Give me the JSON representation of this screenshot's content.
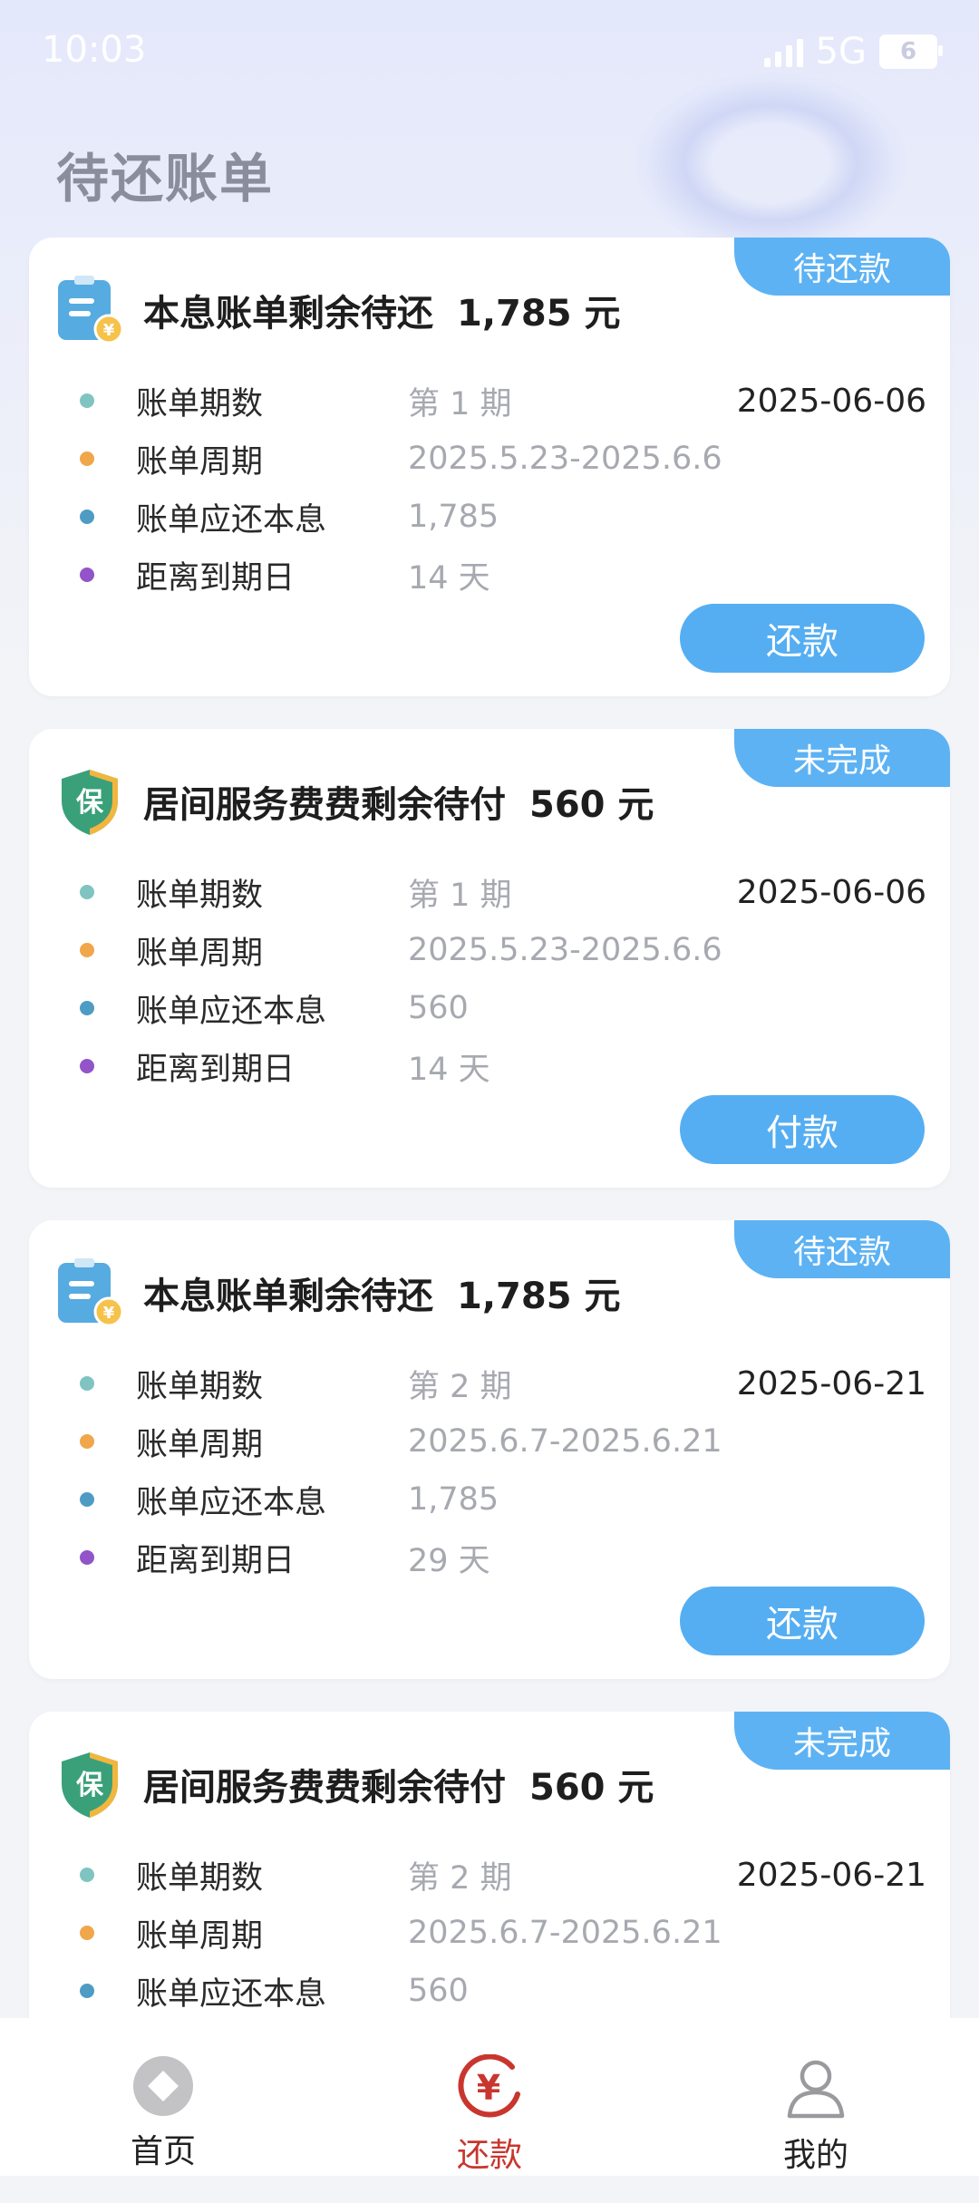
{
  "status_bar": {
    "time": "10:03",
    "network": "5G",
    "battery": "6"
  },
  "page_title": "待还账单",
  "colors": {
    "accent": "#5db2f3",
    "dot_period": "#7fc4c0",
    "dot_cycle": "#f0a64a",
    "dot_amount": "#4e9cc4",
    "dot_due": "#9254c8",
    "active_tab": "#c8362e"
  },
  "cards": [
    {
      "icon": "bill-icon",
      "badge": "待还款",
      "title": "本息账单剩余待还",
      "amount": "1,785 元",
      "date": "2025-06-06",
      "rows": [
        {
          "label": "账单期数",
          "value": "第 1 期"
        },
        {
          "label": "账单周期",
          "value": "2025.5.23-2025.6.6"
        },
        {
          "label": "账单应还本息",
          "value": "1,785"
        },
        {
          "label": "距离到期日",
          "value": "14 天"
        }
      ],
      "button": "还款"
    },
    {
      "icon": "shield-icon",
      "badge": "未完成",
      "title": "居间服务费费剩余待付",
      "amount": "560 元",
      "date": "2025-06-06",
      "rows": [
        {
          "label": "账单期数",
          "value": "第 1 期"
        },
        {
          "label": "账单周期",
          "value": "2025.5.23-2025.6.6"
        },
        {
          "label": "账单应还本息",
          "value": "560"
        },
        {
          "label": "距离到期日",
          "value": "14 天"
        }
      ],
      "button": "付款"
    },
    {
      "icon": "bill-icon",
      "badge": "待还款",
      "title": "本息账单剩余待还",
      "amount": "1,785 元",
      "date": "2025-06-21",
      "rows": [
        {
          "label": "账单期数",
          "value": "第 2 期"
        },
        {
          "label": "账单周期",
          "value": "2025.6.7-2025.6.21"
        },
        {
          "label": "账单应还本息",
          "value": "1,785"
        },
        {
          "label": "距离到期日",
          "value": "29 天"
        }
      ],
      "button": "还款"
    },
    {
      "icon": "shield-icon",
      "badge": "未完成",
      "title": "居间服务费费剩余待付",
      "amount": "560 元",
      "date": "2025-06-21",
      "rows": [
        {
          "label": "账单期数",
          "value": "第 2 期"
        },
        {
          "label": "账单周期",
          "value": "2025.6.7-2025.6.21"
        },
        {
          "label": "账单应还本息",
          "value": "560"
        }
      ]
    }
  ],
  "shield_char": "保",
  "yuan_char": "¥",
  "tabs": [
    {
      "label": "首页",
      "icon": "home-icon",
      "active": false
    },
    {
      "label": "还款",
      "icon": "repay-icon",
      "active": true
    },
    {
      "label": "我的",
      "icon": "profile-icon",
      "active": false
    }
  ]
}
